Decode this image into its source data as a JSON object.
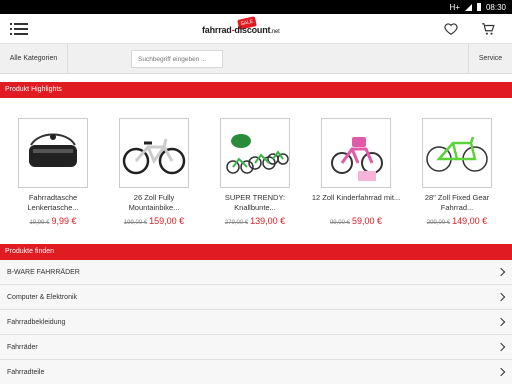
{
  "status": {
    "network": "H+",
    "time": "08:30"
  },
  "header": {
    "logo_main": "fahrrad",
    "logo_dash": "-",
    "logo_second": "discount",
    "logo_tld": ".net",
    "logo_badge": "SALE"
  },
  "toolbar": {
    "categories_label": "Alle Kategorien",
    "search_placeholder": "Suchbegriff eingeben ...",
    "service_label": "Service"
  },
  "highlights": {
    "title": "Produkt Highlights",
    "products": [
      {
        "name": "Fahrradtasche Lenkertasche...",
        "old_price": "19,99 €",
        "price": "9,99 €"
      },
      {
        "name": "26 Zoll Fully Mountainbike...",
        "old_price": "199,00 €",
        "price": "159,00 €"
      },
      {
        "name": "SUPER TRENDY: Knallbunte...",
        "old_price": "279,00 €",
        "price": "139,00 €"
      },
      {
        "name": "12 Zoll Kinderfahrrad mit...",
        "old_price": "99,00 €",
        "price": "59,00 €"
      },
      {
        "name": "28\" Zoll Fixed Gear Fahrrad...",
        "old_price": "299,00 €",
        "price": "149,00 €"
      }
    ]
  },
  "find": {
    "title": "Produkte finden",
    "items": [
      {
        "label": "B-WARE FAHRRÄDER"
      },
      {
        "label": "Computer & Elektronik"
      },
      {
        "label": "Fahrradbekleidung"
      },
      {
        "label": "Fahrräder"
      },
      {
        "label": "Fahrradteile"
      }
    ]
  },
  "colors": {
    "accent": "#e01b22",
    "bar_bg": "#f0f0f0"
  }
}
